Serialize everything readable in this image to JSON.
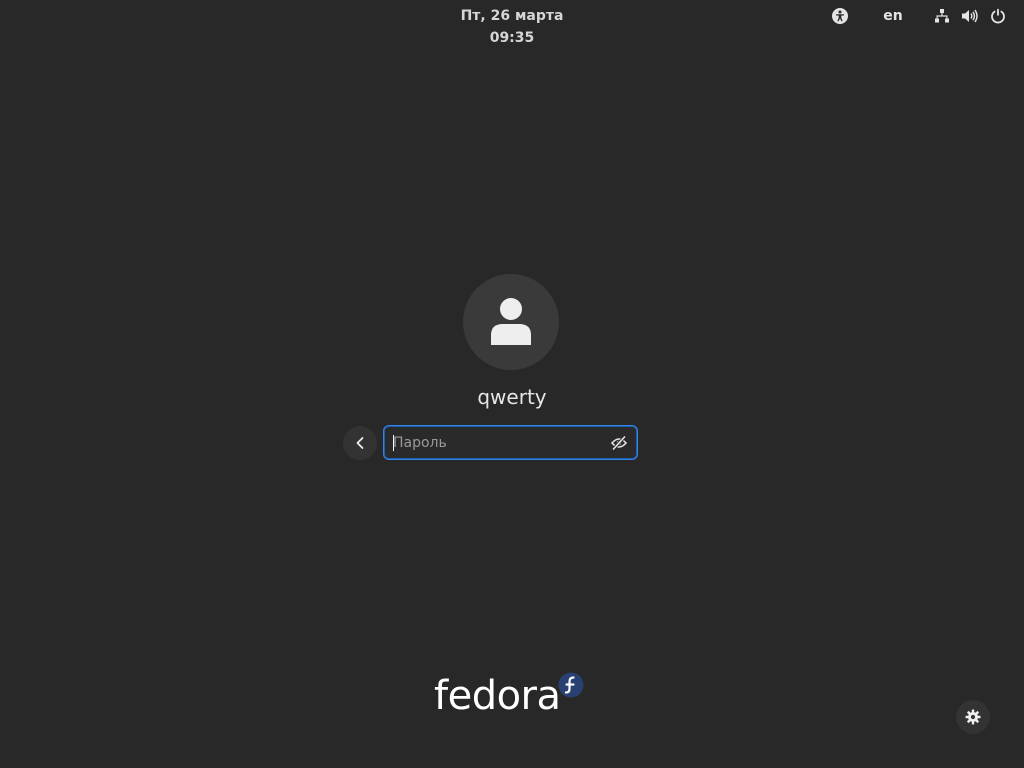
{
  "topbar": {
    "clock": "Пт, 26 марта  09:35",
    "keyboard_layout": "en",
    "icons": [
      "accessibility-icon",
      "network-icon",
      "volume-icon",
      "power-icon"
    ]
  },
  "login": {
    "username": "qwerty",
    "password_placeholder": "Пароль",
    "password_value": "",
    "avatar_icon": "user-icon",
    "back_icon": "chevron-left-icon",
    "reveal_icon": "eye-slash-icon"
  },
  "branding": {
    "logo_text": "fedora",
    "logo_badge_color": "#294172"
  },
  "settings": {
    "icon": "gear-icon"
  },
  "colors": {
    "background": "#282828",
    "accent": "#3584e4"
  }
}
